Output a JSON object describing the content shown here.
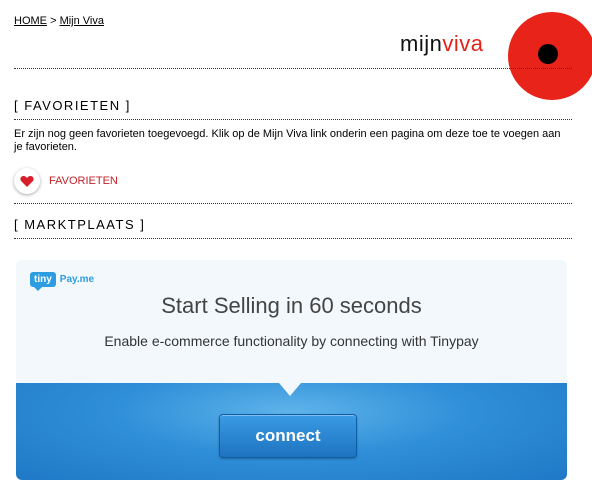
{
  "breadcrumb": {
    "home": "HOME",
    "separator": ">",
    "current": "Mijn Viva"
  },
  "brand": {
    "prefix": "mijn",
    "suffix": "viva",
    "accent_color": "#e2231a"
  },
  "favorieten": {
    "heading": "[ FAVORIETEN ]",
    "message": "Er zijn nog geen favorieten toegevoegd. Klik op de Mijn Viva link onderin een pagina om deze toe te voegen aan je favorieten.",
    "button_label": "FAVORIETEN",
    "icon": "heart-icon"
  },
  "marktplaats": {
    "heading": "[ MARKTPLAATS ]"
  },
  "tinypay": {
    "logo_tiny": "tiny",
    "logo_pay": "Pay.me",
    "title": "Start Selling in 60 seconds",
    "subtitle": "Enable e-commerce functionality by connecting with Tinypay",
    "connect_label": "connect",
    "accent_color": "#2b9de0"
  }
}
